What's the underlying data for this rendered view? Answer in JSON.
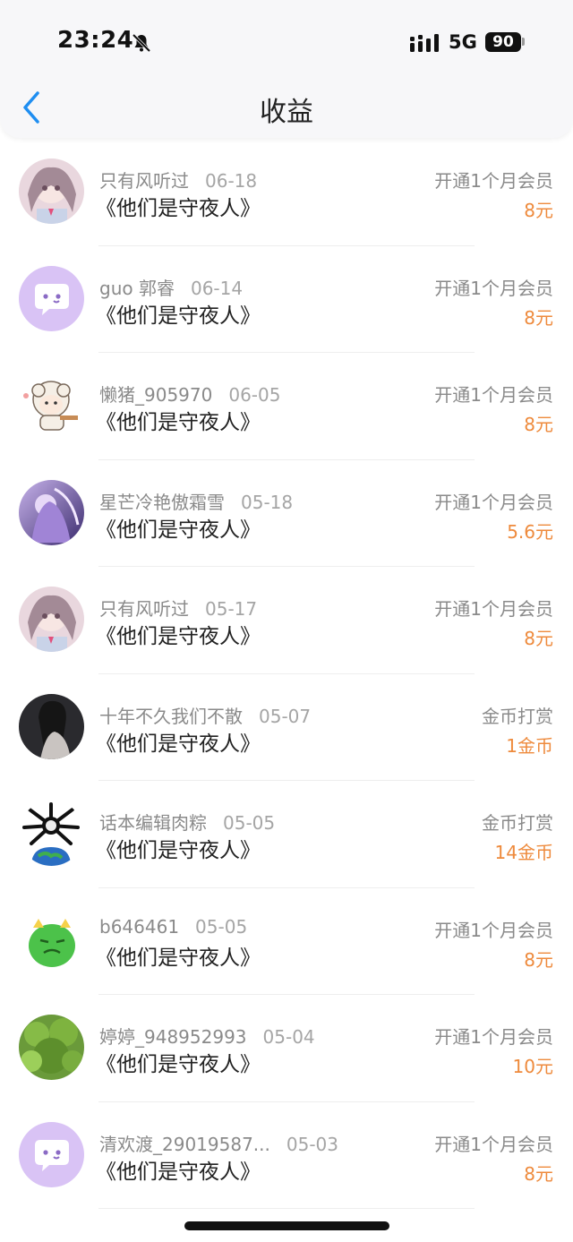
{
  "status_bar": {
    "time": "23:24",
    "network": "5G",
    "battery": "90"
  },
  "header": {
    "title": "收益"
  },
  "items": [
    {
      "name": "只有风听过",
      "date": "06-18",
      "book": "《他们是守夜人》",
      "type": "开通1个月会员",
      "amount": "8元",
      "avatar": "anime-girl-pink"
    },
    {
      "name": "guo 郭睿",
      "date": "06-14",
      "book": "《他们是守夜人》",
      "type": "开通1个月会员",
      "amount": "8元",
      "avatar": "default-chat-bubble"
    },
    {
      "name": "懒猪_905970",
      "date": "06-05",
      "book": "《他们是守夜人》",
      "type": "开通1个月会员",
      "amount": "8元",
      "avatar": "sheep-cartoon"
    },
    {
      "name": "星芒冷艳傲霜雪",
      "date": "05-18",
      "book": "《他们是守夜人》",
      "type": "开通1个月会员",
      "amount": "5.6元",
      "avatar": "anime-girl-purple"
    },
    {
      "name": "只有风听过",
      "date": "05-17",
      "book": "《他们是守夜人》",
      "type": "开通1个月会员",
      "amount": "8元",
      "avatar": "anime-girl-pink"
    },
    {
      "name": "十年不久我们不散",
      "date": "05-07",
      "book": "《他们是守夜人》",
      "type": "金币打赏",
      "amount": "1金币",
      "avatar": "dark-portrait"
    },
    {
      "name": "话本编辑肉粽",
      "date": "05-05",
      "book": "《他们是守夜人》",
      "type": "金币打赏",
      "amount": "14金币",
      "avatar": "skull-earth"
    },
    {
      "name": "b646461",
      "date": "05-05",
      "book": "《他们是守夜人》",
      "type": "开通1个月会员",
      "amount": "8元",
      "avatar": "green-dragon"
    },
    {
      "name": "婷婷_948952993",
      "date": "05-04",
      "book": "《他们是守夜人》",
      "type": "开通1个月会员",
      "amount": "10元",
      "avatar": "green-bush"
    },
    {
      "name": "清欢渡_29019587...",
      "date": "05-03",
      "book": "《他们是守夜人》",
      "type": "开通1个月会员",
      "amount": "8元",
      "avatar": "default-chat-bubble"
    }
  ],
  "colors": {
    "accent_orange": "#ee8a3c",
    "back_blue": "#1f8ef1",
    "default_avatar": "#d9c3f5"
  }
}
